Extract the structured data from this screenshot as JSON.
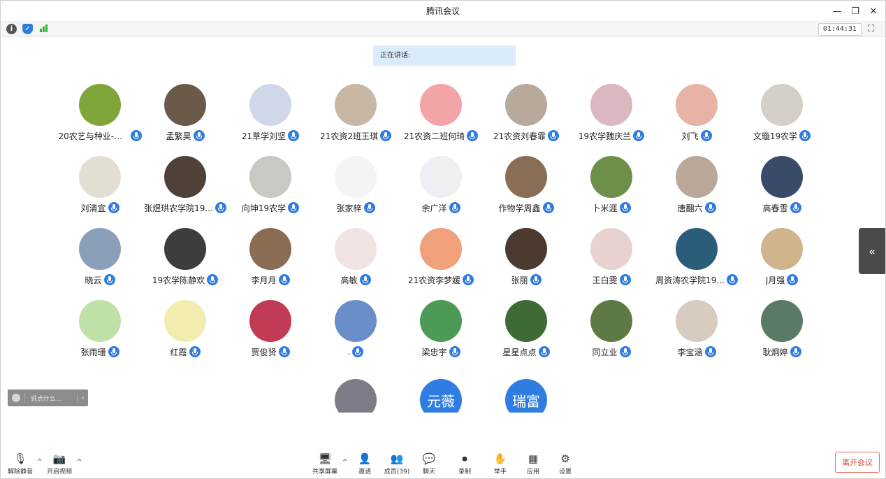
{
  "window": {
    "title": "腾讯会议"
  },
  "infobar": {
    "timer": "01:44:31"
  },
  "speaking": {
    "label": "正在讲话:"
  },
  "participants": [
    {
      "name": "20农艺与种业-杨...",
      "avatar_color": "#7ea43a"
    },
    {
      "name": "孟繁昊",
      "avatar_color": "#6b5a4a"
    },
    {
      "name": "21草学刘坚",
      "avatar_color": "#cfd8e8"
    },
    {
      "name": "21农资2班王琪",
      "avatar_color": "#c9b7a6"
    },
    {
      "name": "21农资二班何琦",
      "avatar_color": "#f3a4a7"
    },
    {
      "name": "21农资刘春霏",
      "avatar_color": "#b7a99c"
    },
    {
      "name": "19农学魏庆兰",
      "avatar_color": "#d9b8bf"
    },
    {
      "name": "刘飞",
      "avatar_color": "#e6b3a6"
    },
    {
      "name": "文璇19农学",
      "avatar_color": "#d4cfc9"
    },
    {
      "name": "刘清宜",
      "avatar_color": "#e3ded2"
    },
    {
      "name": "张煜珙农学院19...",
      "avatar_color": "#4f4137"
    },
    {
      "name": "向坤19农学",
      "avatar_color": "#cbc7c2"
    },
    {
      "name": "张家梓",
      "avatar_color": "#f4f4f4"
    },
    {
      "name": "余广洋",
      "avatar_color": "#efeff3"
    },
    {
      "name": "作物学周鑫",
      "avatar_color": "#8a6d55"
    },
    {
      "name": "卜米涯",
      "avatar_color": "#6d8f4a"
    },
    {
      "name": "唐翻六",
      "avatar_color": "#b9a79a"
    },
    {
      "name": "高春雪",
      "avatar_color": "#3a4b69"
    },
    {
      "name": "晓云",
      "avatar_color": "#8aa0b8"
    },
    {
      "name": "19农学陈静欢",
      "avatar_color": "#3d3d3d"
    },
    {
      "name": "李月月",
      "avatar_color": "#8a6c52"
    },
    {
      "name": "高敏",
      "avatar_color": "#f1e3e1"
    },
    {
      "name": "21农资李梦媛",
      "avatar_color": "#f0a07b"
    },
    {
      "name": "张丽",
      "avatar_color": "#4a3a30"
    },
    {
      "name": "王白雯",
      "avatar_color": "#e7d2cf"
    },
    {
      "name": "周资涛农学院19...",
      "avatar_color": "#2b5d7a"
    },
    {
      "name": "J月强",
      "avatar_color": "#d2b48c"
    },
    {
      "name": "张雨珊",
      "avatar_color": "#bfe0a6"
    },
    {
      "name": "红霞",
      "avatar_color": "#f3ecb0"
    },
    {
      "name": "贾俊贤",
      "avatar_color": "#c23b56"
    },
    {
      "name": ".",
      "avatar_color": "#6a8ec9"
    },
    {
      "name": "梁忠宇",
      "avatar_color": "#4c9a56"
    },
    {
      "name": "星星点点",
      "avatar_color": "#3e6a36"
    },
    {
      "name": "同立业",
      "avatar_color": "#5d7a44"
    },
    {
      "name": "李宝涵",
      "avatar_color": "#d8cbbf"
    },
    {
      "name": "耿炯婷",
      "avatar_color": "#5b7a63"
    }
  ],
  "partial_row": [
    {
      "avatar_text": "",
      "avatar_color": "#7c7c86"
    },
    {
      "avatar_text": "元薇",
      "avatar_color": "#2f7de1"
    },
    {
      "avatar_text": "瑞富",
      "avatar_color": "#2f7de1"
    }
  ],
  "chat": {
    "placeholder": "说点什么..."
  },
  "toolbar": {
    "mute": "解除静音",
    "video": "开启视频",
    "share": "共享屏幕",
    "invite": "邀请",
    "members": "成员(39)",
    "chat": "聊天",
    "record": "录制",
    "raise": "举手",
    "apps": "应用",
    "settings": "设置",
    "leave": "离开会议"
  }
}
